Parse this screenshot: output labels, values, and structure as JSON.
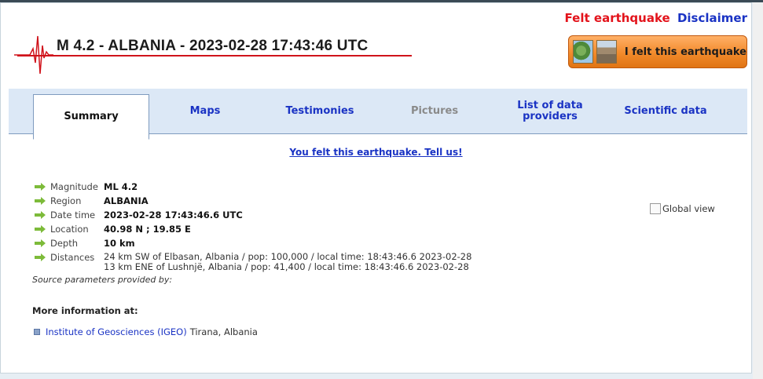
{
  "header": {
    "title": "M 4.2 - ALBANIA - 2023-02-28 17:43:46 UTC",
    "felt_link": "Felt earthquake",
    "disclaimer_link": "Disclaimer",
    "felt_button": "I felt this earthquake"
  },
  "tabs": [
    {
      "label": "Summary",
      "state": "active"
    },
    {
      "label": "Maps",
      "state": "normal"
    },
    {
      "label": "Testimonies",
      "state": "normal"
    },
    {
      "label": "Pictures",
      "state": "disabled"
    },
    {
      "label": "List of data providers",
      "state": "normal"
    },
    {
      "label": "Scientific data",
      "state": "normal"
    }
  ],
  "tell_us": "You felt this earthquake. Tell us!",
  "details": {
    "magnitude": {
      "label": "Magnitude",
      "value": "ML 4.2"
    },
    "region": {
      "label": "Region",
      "value": "ALBANIA"
    },
    "datetime": {
      "label": "Date time",
      "value": "2023-02-28 17:43:46.6 UTC"
    },
    "location": {
      "label": "Location",
      "value": "40.98 N ; 19.85 E"
    },
    "depth": {
      "label": "Depth",
      "value": "10 km"
    },
    "distances": {
      "label": "Distances",
      "lines": [
        "24 km SW of Elbasan, Albania / pop: 100,000 / local time: 18:43:46.6 2023-02-28",
        "13 km ENE of Lushnjë, Albania / pop: 41,400 / local time: 18:43:46.6 2023-02-28"
      ]
    }
  },
  "source_params": "Source parameters provided by:",
  "more_info": {
    "heading": "More information at:",
    "institute_link": "Institute of Geosciences (IGEO)",
    "institute_place": "Tirana, Albania"
  },
  "global_view": "Global view",
  "colors": {
    "accent_red": "#e3131b",
    "link_blue": "#1a33c4",
    "button_orange": "#f28a2b",
    "tab_bg": "#dce8f6",
    "arrow_green": "#7dbb3a"
  }
}
